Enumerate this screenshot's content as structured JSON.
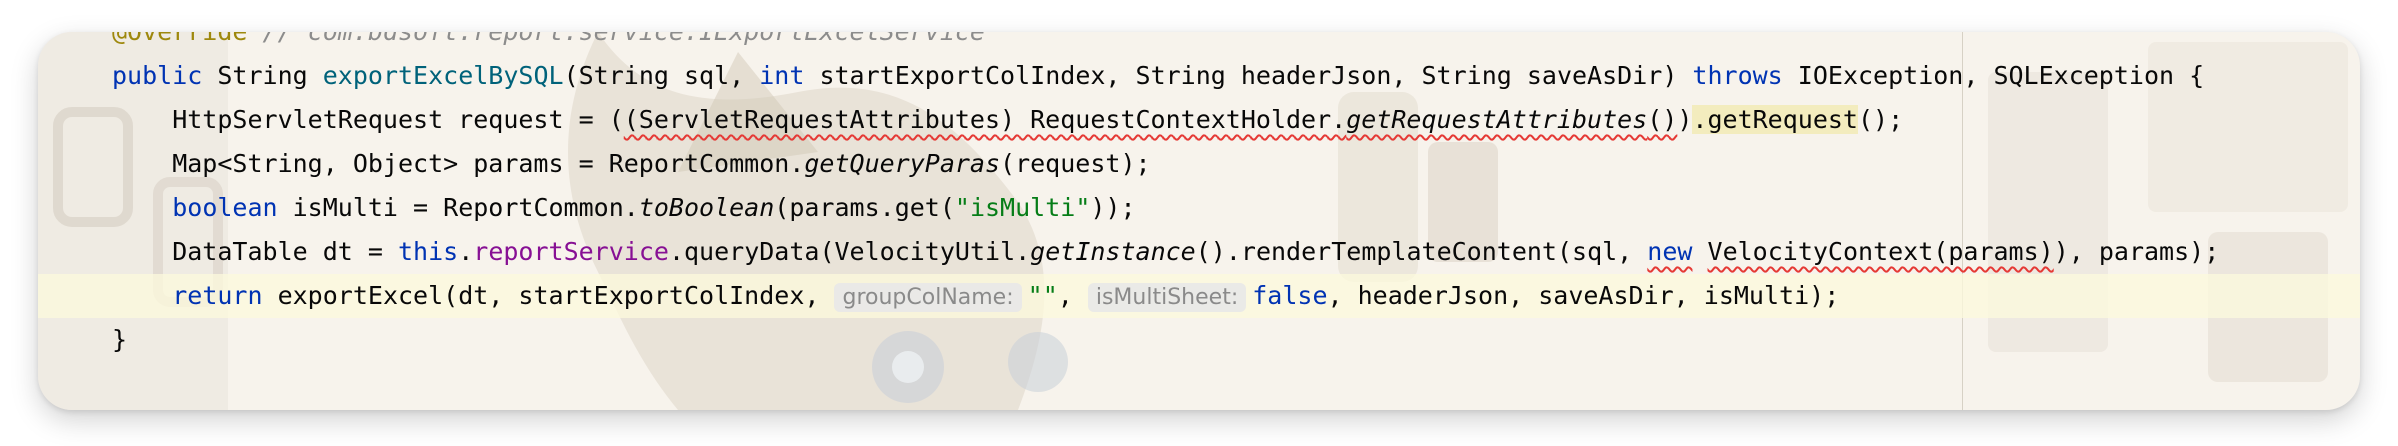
{
  "editor": {
    "language": "java",
    "lines": [
      {
        "tokens": [
          [
            "ann",
            "@Override"
          ],
          [
            "cmt",
            " // com.bdsoft.report.service.IExportExcelService"
          ]
        ]
      },
      {
        "tokens": [
          [
            "kw",
            "public"
          ],
          [
            "",
            " String "
          ],
          [
            "fn",
            "exportExcelBySQL"
          ],
          [
            "",
            "(String sql, "
          ],
          [
            "kw",
            "int"
          ],
          [
            "",
            " startExportColIndex, String headerJson, String saveAsDir) "
          ],
          [
            "kw",
            "throws"
          ],
          [
            "",
            " IOException, SQLException {"
          ]
        ]
      },
      {
        "tokens": [
          [
            "",
            "    HttpServletRequest request = ("
          ],
          [
            "squig",
            "(ServletRequestAttributes) RequestContextHolder."
          ],
          [
            "squig it",
            "getRequestAttributes"
          ],
          [
            "squig",
            "()"
          ],
          [
            "",
            ")"
          ],
          [
            "hl",
            ".getRequest"
          ],
          [
            "",
            "();"
          ]
        ]
      },
      {
        "tokens": [
          [
            "",
            "    Map<String, Object> params = ReportCommon."
          ],
          [
            "it",
            "getQueryParas"
          ],
          [
            "",
            "(request);"
          ]
        ]
      },
      {
        "tokens": [
          [
            "",
            "    "
          ],
          [
            "kw",
            "boolean"
          ],
          [
            "",
            " isMulti = ReportCommon."
          ],
          [
            "it",
            "toBoolean"
          ],
          [
            "",
            "(params.get("
          ],
          [
            "str",
            "\"isMulti\""
          ],
          [
            "",
            "));"
          ]
        ]
      },
      {
        "tokens": [
          [
            "",
            "    DataTable dt = "
          ],
          [
            "kw",
            "this"
          ],
          [
            "",
            "."
          ],
          [
            "field",
            "reportService"
          ],
          [
            "",
            ".queryData(VelocityUtil."
          ],
          [
            "it",
            "getInstance"
          ],
          [
            "",
            "().renderTemplateContent(sql, "
          ],
          [
            "kw squig",
            "new"
          ],
          [
            "",
            " "
          ],
          [
            "squig",
            "VelocityContext(params)"
          ],
          [
            "",
            "), params);"
          ]
        ]
      },
      {
        "current": true,
        "tokens": [
          [
            "",
            "    "
          ],
          [
            "kw",
            "return"
          ],
          [
            "",
            " exportExcel(dt, startExportColIndex, "
          ],
          [
            "hint",
            "groupColName:"
          ],
          [
            "str",
            "\"\""
          ],
          [
            "",
            ", "
          ],
          [
            "hint",
            "isMultiSheet:"
          ],
          [
            "kw",
            "false"
          ],
          [
            "",
            ", headerJson, saveAsDir, isMulti);"
          ]
        ]
      },
      {
        "tokens": [
          [
            "",
            "}"
          ]
        ]
      }
    ]
  }
}
